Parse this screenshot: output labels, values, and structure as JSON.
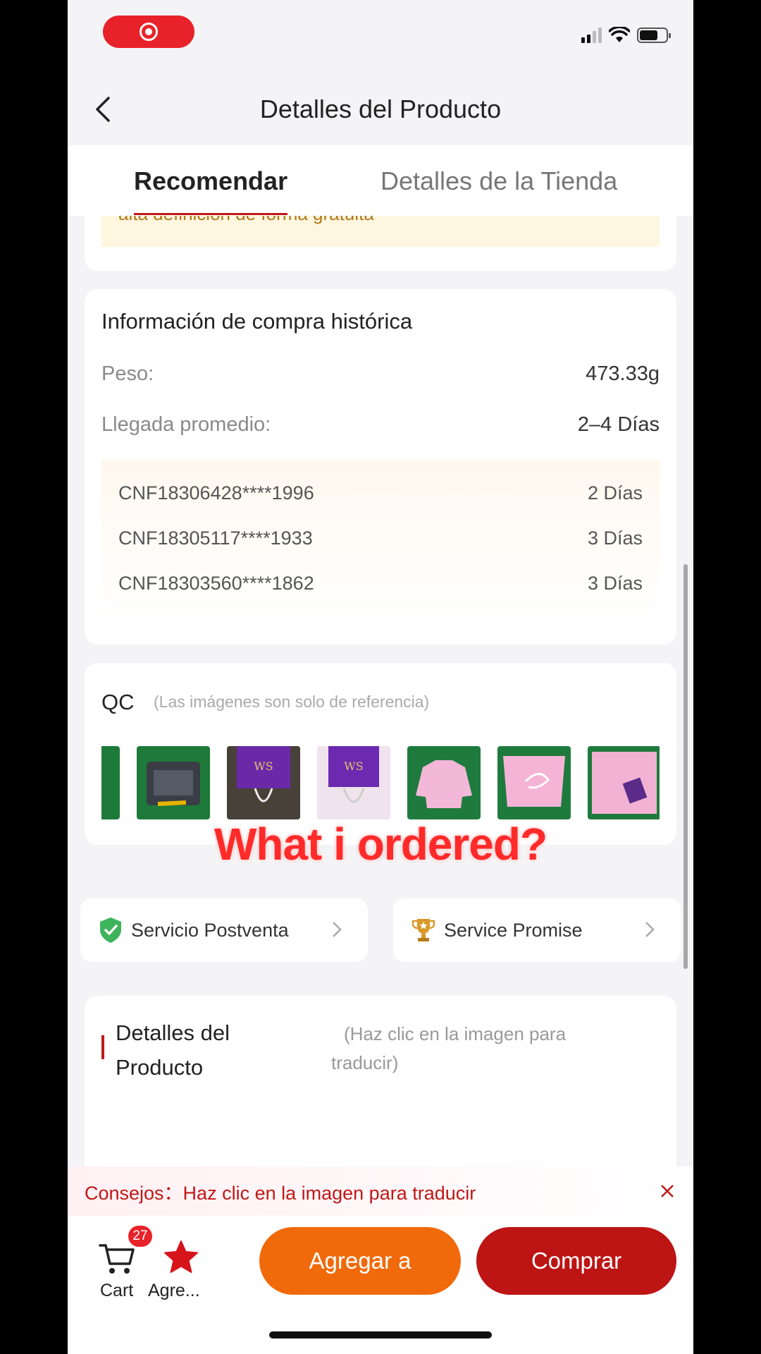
{
  "status_bar": {
    "record_icon": "screen-record-icon"
  },
  "header": {
    "title": "Detalles del Producto"
  },
  "tabs": [
    {
      "label": "Recomendar",
      "active": true
    },
    {
      "label": "Detalles de la Tienda",
      "active": false
    }
  ],
  "notice": {
    "text": "alta definición de forma gratuita"
  },
  "history": {
    "title": "Información de compra histórica",
    "weight_label": "Peso:",
    "weight_value": "473.33g",
    "arrival_label": "Llegada promedio:",
    "arrival_value": "2–4 Días",
    "orders": [
      {
        "id": "CNF18306428****1996",
        "days": "2 Días"
      },
      {
        "id": "CNF18305117****1933",
        "days": "3 Días"
      },
      {
        "id": "CNF18303560****1862",
        "days": "3 Días"
      }
    ]
  },
  "qc": {
    "title": "QC",
    "note": "(Las imágenes son solo de referencia)",
    "thumbnails": [
      "dark-clothing-photo",
      "package-bag-photo",
      "purple-label-photo",
      "purple-label-closeup-photo",
      "pink-sweater-photo",
      "pink-sweater-back-photo",
      "pink-sweater-folded-photo"
    ]
  },
  "overlay_caption": "What i ordered?",
  "services": {
    "after_sales": "Servicio Postventa",
    "promise": "Service Promise"
  },
  "details": {
    "title": "Detalles del Producto",
    "hint": "(Haz clic en la imagen para traducir)"
  },
  "tips": {
    "text": "Consejos：Haz clic en la imagen para traducir"
  },
  "bottom_bar": {
    "cart_label": "Cart",
    "cart_count": "27",
    "favorite_label": "Agre...",
    "add_button": "Agregar a",
    "buy_button": "Comprar"
  },
  "colors": {
    "accent_red": "#c01818",
    "orange": "#f06a0b",
    "notice_bg": "#fff6e0"
  }
}
